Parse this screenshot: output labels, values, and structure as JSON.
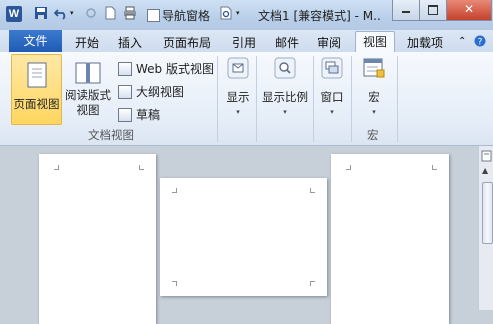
{
  "titlebar": {
    "app_icon_letter": "W",
    "nav_pane_label": "导航窗格",
    "doc_title": "文档1 [兼容模式] - M.."
  },
  "tabs": {
    "file": "文件",
    "items": [
      "开始",
      "插入",
      "页面布局",
      "引用",
      "邮件",
      "审阅",
      "视图",
      "加载项"
    ],
    "active": "视图"
  },
  "ribbon": {
    "print_layout": "页面视图",
    "read_layout_line1": "阅读版式",
    "read_layout_line2": "视图",
    "web_layout": "Web 版式视图",
    "outline": "大纲视图",
    "draft": "草稿",
    "group_doc_views": "文档视图",
    "show": "显示",
    "zoom": "显示比例",
    "window": "窗口",
    "macros": "宏",
    "group_macros": "宏",
    "dropdown_arrow": "▾"
  },
  "colors": {
    "file_tab": "#2b5fb4",
    "selected_button": "#ffd660",
    "document_background": "#c7cfd9"
  }
}
